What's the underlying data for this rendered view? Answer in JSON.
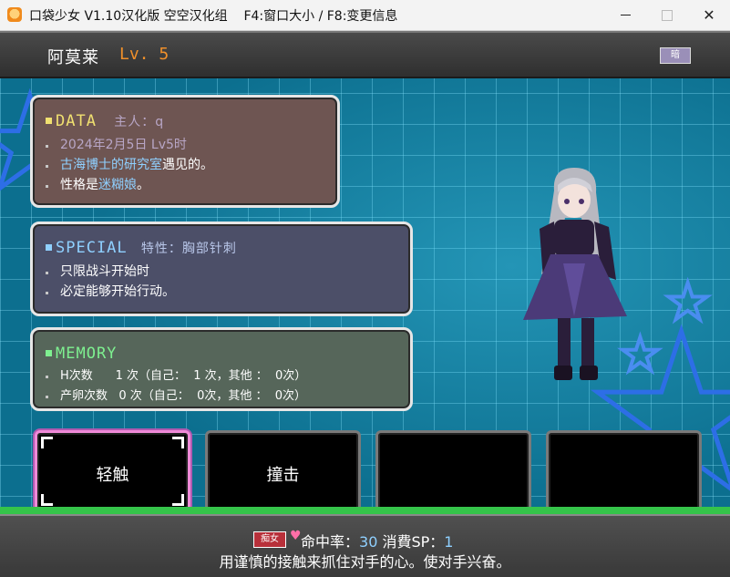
{
  "window": {
    "title": "口袋少女 V1.10汉化版 空空汉化组    F4:窗口大小 / F8:变更信息",
    "min_glyph": "—",
    "max_glyph": "□",
    "close_glyph": "✕"
  },
  "header": {
    "name": "阿莫莱",
    "level": "Lv. 5",
    "toggle_label": "暗"
  },
  "data_panel": {
    "title": "DATA",
    "owner": "主人：q",
    "line1": "2024年2月5日 Lv5时",
    "line2_place": "古海博士的研究室",
    "line2_suffix": "遇见的。",
    "line3_prefix": "性格是",
    "line3_trait": "迷糊娘",
    "line3_suffix": "。"
  },
  "special_panel": {
    "title": "SPECIAL",
    "trait": "特性：胸部针刺",
    "line1": "只限战斗开始时",
    "line2": "必定能够开始行动。"
  },
  "memory_panel": {
    "title": "MEMORY",
    "row1": "H次数      1 次（自己：  1 次，其他 ：  0次）",
    "row2": "产卵次数   0 次（自己：  0次，其他 ：  0次）"
  },
  "skills": [
    {
      "label": "轻触",
      "selected": true
    },
    {
      "label": "撞击",
      "selected": false
    },
    {
      "label": "",
      "selected": false
    },
    {
      "label": "",
      "selected": false
    }
  ],
  "footer": {
    "tag": "痴女",
    "heart": "♥",
    "hit_label": "命中率：",
    "hit_value": "30",
    "sp_label": " 消費SP：",
    "sp_value": "1",
    "description": "用谨慎的接触来抓住对手的心。使对手兴奋。"
  },
  "colors": {
    "accent_level": "#f0902a",
    "highlight_blue": "#8fd0ff",
    "selected_skill": "#f08ad8"
  }
}
